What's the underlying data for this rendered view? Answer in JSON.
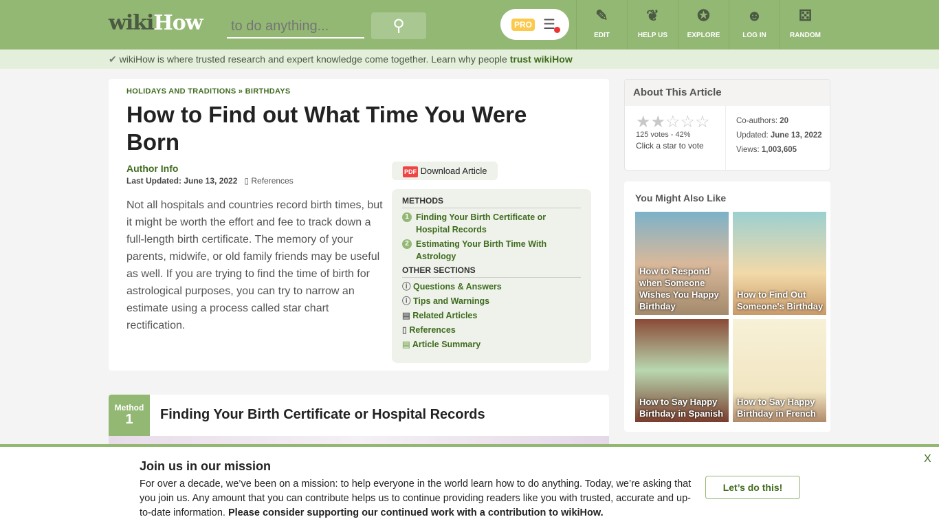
{
  "header": {
    "logo_a": "wiki",
    "logo_b": "How",
    "search_placeholder": "to do anything...",
    "pro": "PRO",
    "nav": [
      {
        "label": "EDIT",
        "icon": "✎"
      },
      {
        "label": "HELP US",
        "icon": "❦"
      },
      {
        "label": "EXPLORE",
        "icon": "✪"
      },
      {
        "label": "LOG IN",
        "icon": "☻"
      },
      {
        "label": "RANDOM",
        "icon": "⚄"
      }
    ]
  },
  "trust": {
    "text": "wikiHow is where trusted research and expert knowledge come together. Learn why people ",
    "link": "trust wikiHow"
  },
  "article": {
    "crumb1": "HOLIDAYS AND TRADITIONS",
    "crumb_sep": "»",
    "crumb2": "BIRTHDAYS",
    "title": "How to Find out What Time You Were Born",
    "author": "Author Info",
    "updated": "Last Updated: June 13, 2022",
    "references": "References",
    "download": "Download Article",
    "intro": "Not all hospitals and countries record birth times, but it might be worth the effort and fee to track down a full-length birth certificate. The memory of your parents, midwife, or old family friends may be useful as well. If you are trying to find the time of birth for astrological purposes, you can try to narrow an estimate using a process called star chart rectification.",
    "toc": {
      "methods_label": "METHODS",
      "methods": [
        "Finding Your Birth Certificate or Hospital Records",
        "Estimating Your Birth Time With Astrology"
      ],
      "other_label": "OTHER SECTIONS",
      "other": [
        "Questions & Answers",
        "Tips and Warnings",
        "Related Articles",
        "References",
        "Article Summary"
      ]
    }
  },
  "method": {
    "label": "Method",
    "number": "1",
    "title": "Finding Your Birth Certificate or Hospital Records"
  },
  "about": {
    "title": "About This Article",
    "rating": 2,
    "votes": "125 votes - 42%",
    "vote_prompt": "Click a star to vote",
    "coauthors_label": "Co-authors: ",
    "coauthors": "20",
    "updated_label": "Updated: ",
    "updated": "June 13, 2022",
    "views_label": "Views: ",
    "views": "1,003,605"
  },
  "related": {
    "title": "You Might Also Like",
    "items": [
      "How to Respond when Someone Wishes You Happy Birthday",
      "How to Find Out Someone's Birthday",
      "How to Say Happy Birthday in Spanish",
      "How to Say Happy Birthday in French"
    ]
  },
  "banner": {
    "title": "Join us in our mission",
    "text": "For over a decade, we’ve been on a mission: to help everyone in the world learn how to do anything. Today, we’re asking that you join us. Any amount that you can contribute helps us to continue providing readers like you with trusted, accurate and up-to-date information. ",
    "bold": "Please consider supporting our continued work with a contribution to wikiHow.",
    "button": "Let’s do this!",
    "close": "X"
  }
}
